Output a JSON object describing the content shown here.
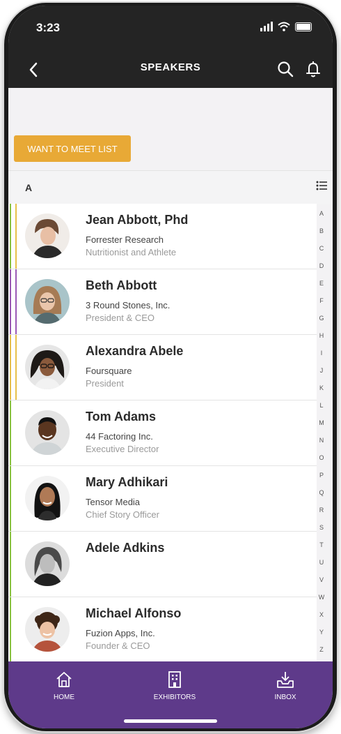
{
  "status": {
    "time": "3:23"
  },
  "nav": {
    "title": "SPEAKERS"
  },
  "meet_button": "WANT TO MEET LIST",
  "section": "A",
  "colors": {
    "accent": "#e8a936",
    "tabbar": "#5e3a8a",
    "header": "#242424",
    "bar_yellow": "#e8c04a",
    "bar_green": "#8ac440",
    "bar_purple": "#9b59b6"
  },
  "speakers": [
    {
      "name": "Jean Abbott, Phd",
      "company": "Forrester Research",
      "title": "Nutritionist and Athlete"
    },
    {
      "name": "Beth Abbott",
      "company": "3 Round Stones, Inc.",
      "title": "President & CEO"
    },
    {
      "name": "Alexandra Abele",
      "company": "Foursquare",
      "title": "President"
    },
    {
      "name": "Tom Adams",
      "company": "44 Factoring Inc.",
      "title": "Executive Director"
    },
    {
      "name": "Mary Adhikari",
      "company": "Tensor Media",
      "title": "Chief Story Officer"
    },
    {
      "name": "Adele Adkins",
      "company": "",
      "title": ""
    },
    {
      "name": "Michael Alfonso",
      "company": "Fuzion Apps, Inc.",
      "title": "Founder & CEO"
    }
  ],
  "alphabet": [
    "A",
    "B",
    "C",
    "D",
    "E",
    "F",
    "G",
    "H",
    "I",
    "J",
    "K",
    "L",
    "M",
    "N",
    "O",
    "P",
    "Q",
    "R",
    "S",
    "T",
    "U",
    "V",
    "W",
    "X",
    "Y",
    "Z"
  ],
  "tabs": {
    "home": "HOME",
    "exhibitors": "EXHIBITORS",
    "inbox": "INBOX"
  }
}
